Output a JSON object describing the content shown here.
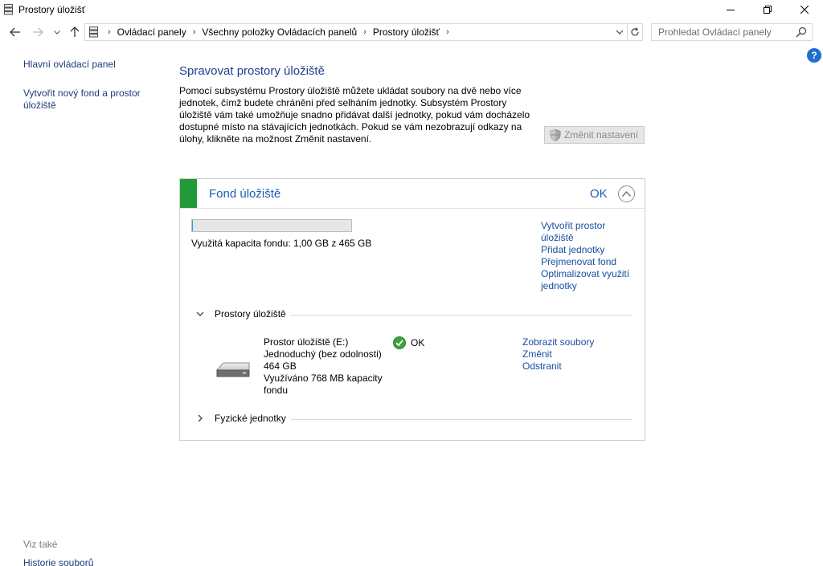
{
  "window": {
    "title": "Prostory úložišť"
  },
  "address": {
    "breadcrumbs": [
      "Ovládací panely",
      "Všechny položky Ovládacích panelů",
      "Prostory úložišť"
    ]
  },
  "search": {
    "placeholder": "Prohledat Ovládací panely"
  },
  "left_nav": {
    "home": "Hlavní ovládací panel",
    "create_pool": "Vytvořit nový fond a prostor úložiště",
    "see_also_label": "Viz také",
    "file_history": "Historie souborů"
  },
  "main": {
    "heading": "Spravovat prostory úložiště",
    "description": "Pomocí subsystému Prostory úložiště můžete ukládat soubory na dvě nebo více jednotek, čímž budete chráněni před selháním jednotky. Subsystém Prostory úložiště vám také umožňuje snadno přidávat další jednotky, pokud vám docházelo dostupné místo na stávajících jednotkách. Pokud se vám nezobrazují odkazy na úlohy, klikněte na možnost Změnit nastavení.",
    "change_settings": "Změnit nastavení"
  },
  "pool": {
    "title": "Fond úložiště",
    "status": "OK",
    "capacity_fraction": 0.0022,
    "capacity_label": "Využitá kapacita fondu: 1,00 GB z 465 GB",
    "actions": {
      "create_space": "Vytvořit prostor úložiště",
      "add_drives": "Přidat jednotky",
      "rename_pool": "Přejmenovat fond",
      "optimize": "Optimalizovat využití jednotky"
    },
    "spaces_section": "Prostory úložiště",
    "physical_section": "Fyzické jednotky",
    "space": {
      "name": "Prostor úložiště (E:)",
      "resiliency": "Jednoduchý (bez odolnosti)",
      "size": "464 GB",
      "usage": "Využíváno 768 MB kapacity fondu",
      "status": "OK",
      "actions": {
        "view_files": "Zobrazit soubory",
        "change": "Změnit",
        "delete": "Odstranit"
      }
    }
  },
  "colors": {
    "link": "#1a4ea0",
    "heading": "#1e3e8f",
    "pool_green": "#229a3a",
    "ok_green": "#3aa63a"
  }
}
